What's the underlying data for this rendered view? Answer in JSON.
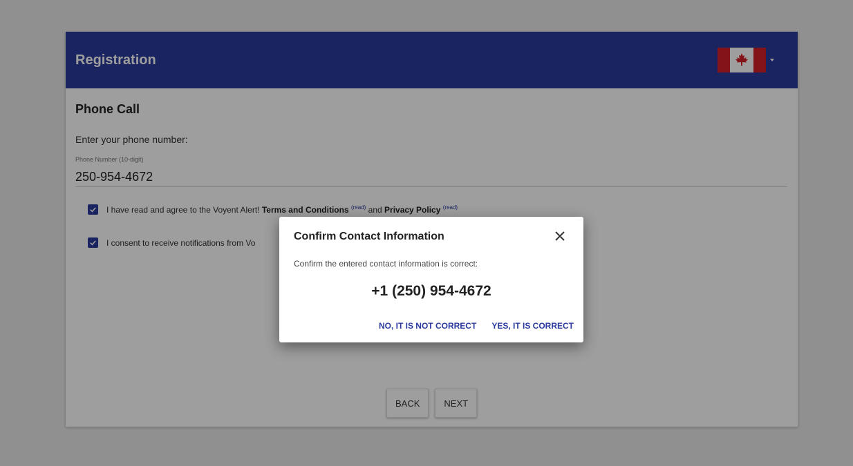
{
  "header": {
    "title": "Registration",
    "flag_icon": "canada-flag-icon"
  },
  "section": {
    "title": "Phone Call"
  },
  "phone_prompt": "Enter your phone number:",
  "phone_field": {
    "label": "Phone Number (10-digit)",
    "value": "250-954-4672"
  },
  "checkboxes": [
    {
      "checked": true,
      "prefix": "I have read and agree to the Voyent Alert! ",
      "terms": "Terms and Conditions",
      "read1": "(read)",
      "and": " and ",
      "privacy": "Privacy Policy",
      "read2": "(read)"
    },
    {
      "checked": true,
      "text": "I consent to receive notifications from Vo"
    }
  ],
  "footer": {
    "back_label": "BACK",
    "next_label": "NEXT"
  },
  "dialog": {
    "title": "Confirm Contact Information",
    "message": "Confirm the entered contact information is correct:",
    "phone": "+1 (250) 954-4672",
    "no_label": "NO, IT IS NOT CORRECT",
    "yes_label": "YES, IT IS CORRECT"
  },
  "colors": {
    "primary": "#2a3a9c",
    "flag_red": "#d42027"
  }
}
